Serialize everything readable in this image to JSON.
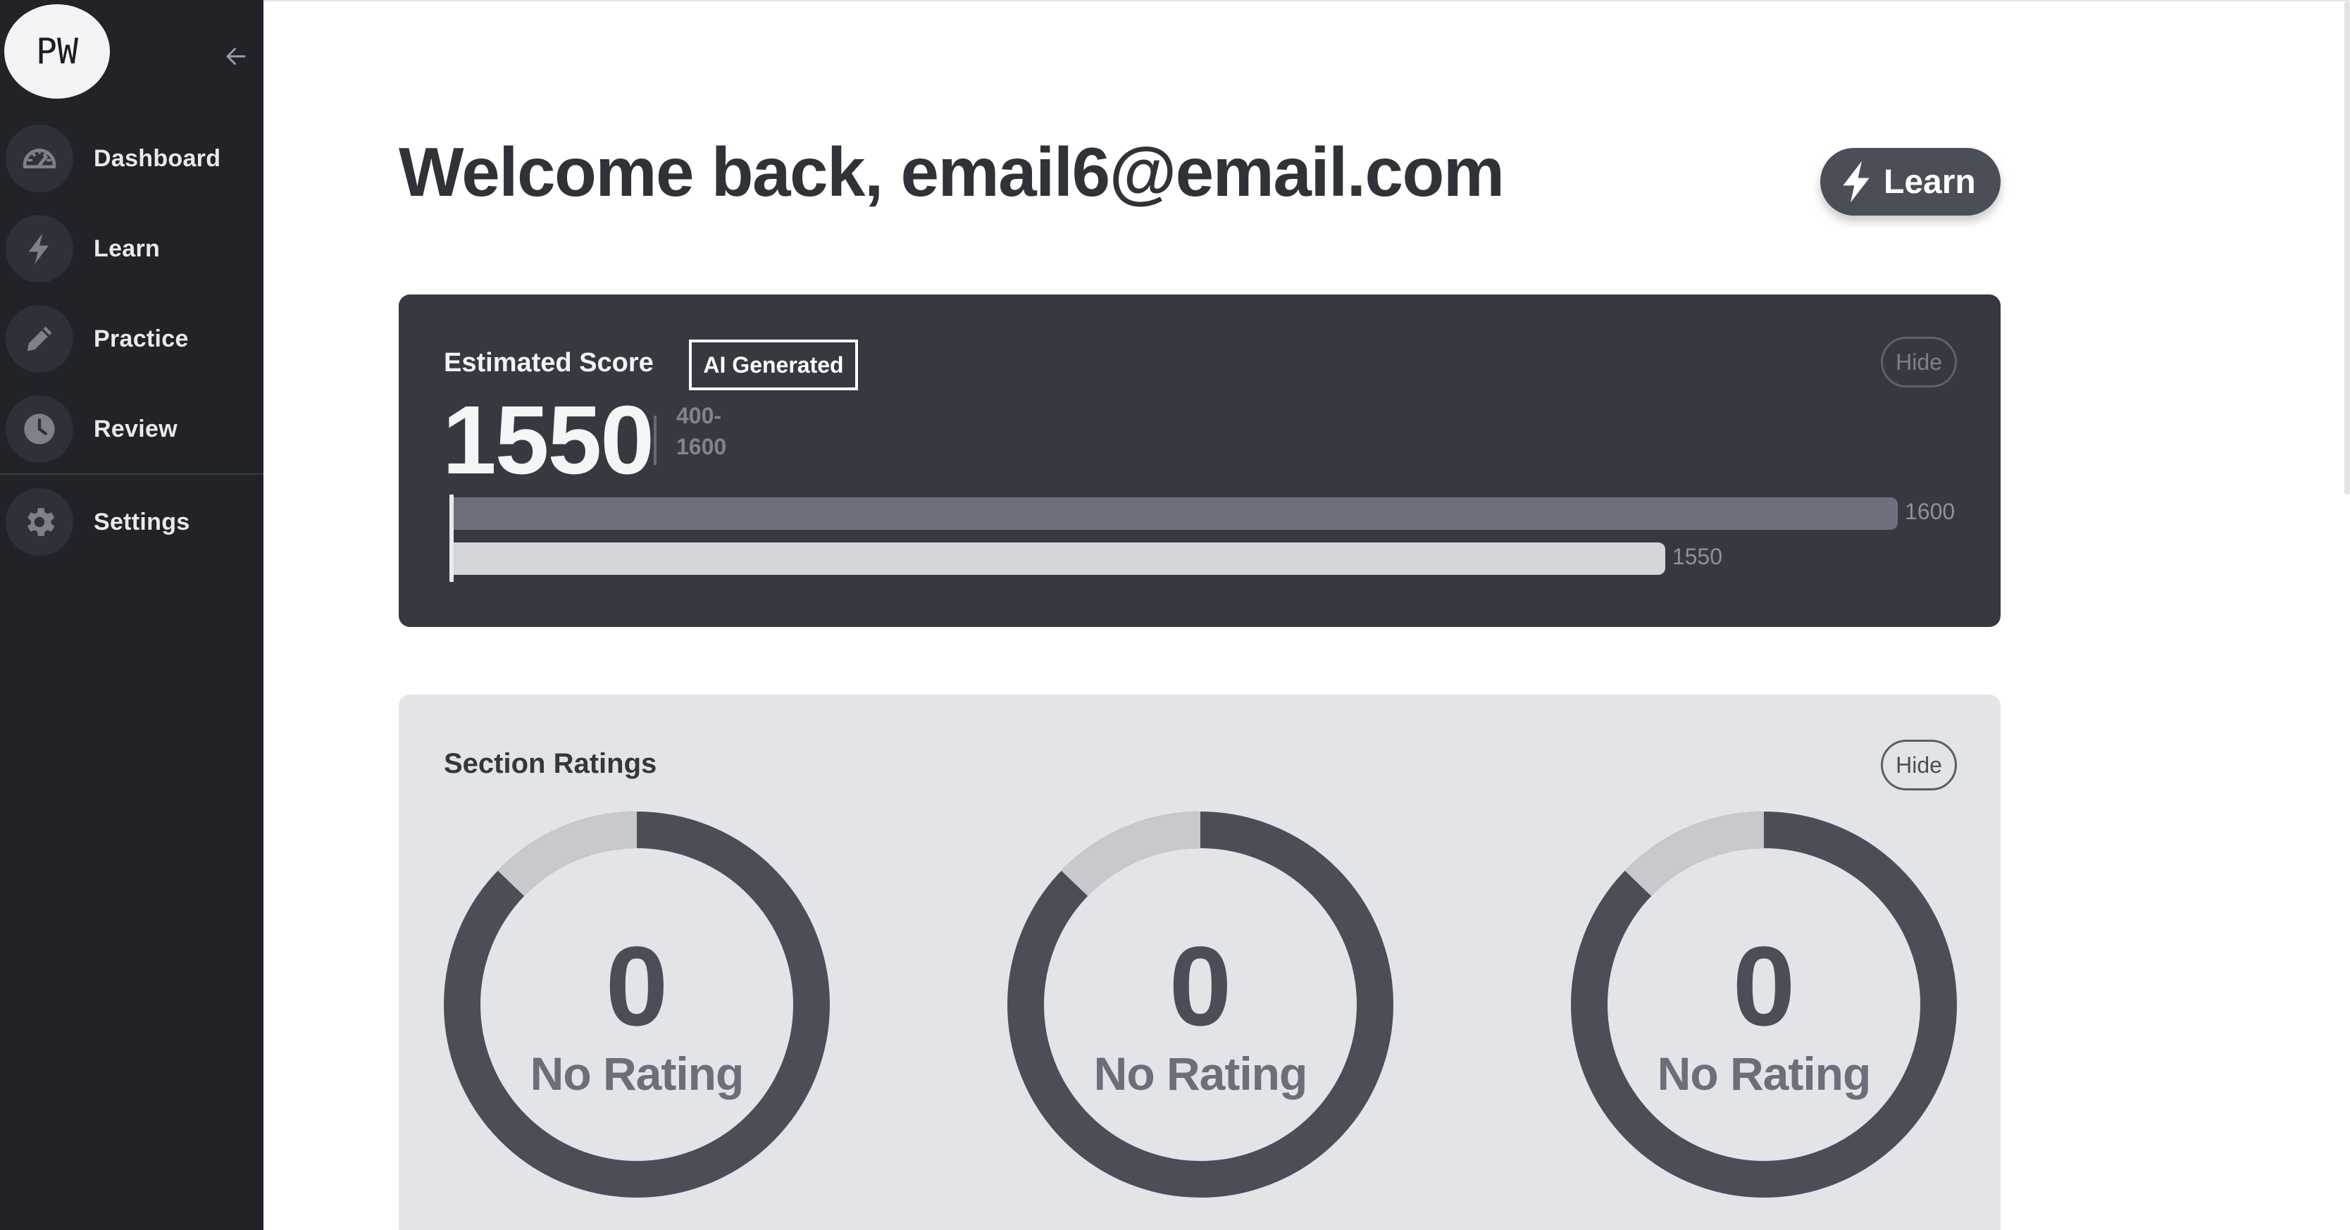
{
  "sidebar": {
    "avatar_initials": "PW",
    "items": [
      {
        "label": "Dashboard",
        "icon": "speedometer-icon"
      },
      {
        "label": "Learn",
        "icon": "bolt-icon"
      },
      {
        "label": "Practice",
        "icon": "pencil-icon"
      },
      {
        "label": "Review",
        "icon": "clock-icon"
      },
      {
        "label": "Settings",
        "icon": "gear-icon"
      }
    ]
  },
  "header": {
    "welcome": "Welcome back, email6@email.com",
    "learn_button": "Learn"
  },
  "score_card": {
    "title": "Estimated Score",
    "badge": "AI Generated",
    "hide_label": "Hide",
    "score": "1550",
    "range_line1": "400-",
    "range_line2": "1600",
    "max_value": 1600,
    "score_value": 1550,
    "max_label": "1600",
    "score_label": "1550"
  },
  "ratings": {
    "title": "Section Ratings",
    "hide_label": "Hide",
    "sections": [
      {
        "value": "0",
        "label": "No Rating"
      },
      {
        "value": "0",
        "label": "No Rating"
      },
      {
        "value": "0",
        "label": "No Rating"
      }
    ]
  },
  "colors": {
    "sidebar_bg": "#212328",
    "card_dark": "#363940",
    "card_light": "#e3e4e8",
    "accent": "#4a4e57"
  }
}
